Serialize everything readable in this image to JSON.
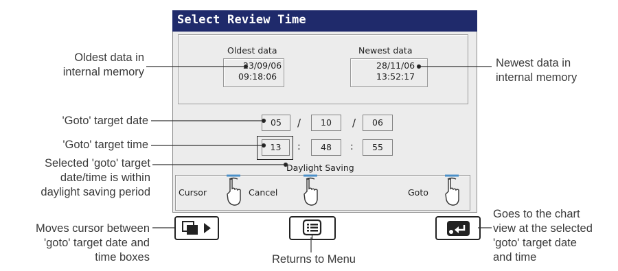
{
  "window": {
    "title": "Select Review Time"
  },
  "range": {
    "oldest_label": "Oldest data",
    "oldest_date": "23/09/06",
    "oldest_time": "09:18:06",
    "newest_label": "Newest data",
    "newest_date": "28/11/06",
    "newest_time": "13:52:17"
  },
  "goto": {
    "day": "05",
    "month": "10",
    "year": "06",
    "hour": "13",
    "minute": "48",
    "second": "55",
    "date_sep": "/",
    "time_sep": ":",
    "daylight_label": "Daylight Saving"
  },
  "softkeys": {
    "cursor": "Cursor",
    "cancel": "Cancel",
    "goto": "Goto"
  },
  "annotations": {
    "oldest_1": "Oldest data in",
    "oldest_2": "internal memory",
    "newest_1": "Newest data in",
    "newest_2": "internal memory",
    "target_date": "'Goto' target date",
    "target_time": "'Goto' target time",
    "dst_1": "Selected 'goto' target",
    "dst_2": "date/time is within",
    "dst_3": "daylight saving period",
    "cursor_1": "Moves cursor between",
    "cursor_2": "'goto' target date and",
    "cursor_3": "time boxes",
    "menu": "Returns to Menu",
    "goto_1": "Goes to the chart",
    "goto_2": "view at the selected",
    "goto_3": "'goto' target date",
    "goto_4": "and time"
  }
}
